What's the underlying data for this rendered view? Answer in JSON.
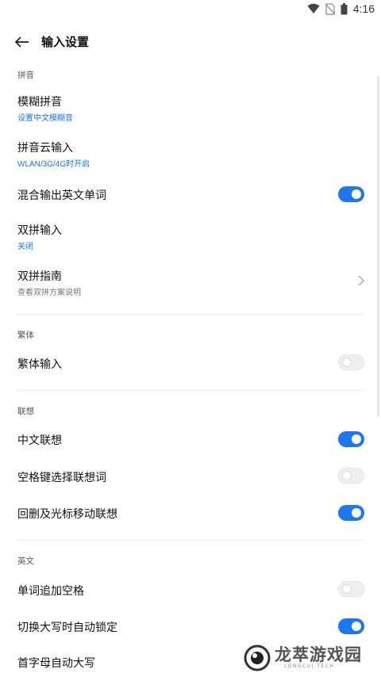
{
  "status_bar": {
    "time": "4:16"
  },
  "header": {
    "title": "输入设置"
  },
  "sections": {
    "pinyin": {
      "title": "拼音",
      "fuzzy": {
        "title": "模糊拼音",
        "subtitle": "设置中文模糊音"
      },
      "cloud": {
        "title": "拼音云输入",
        "subtitle": "WLAN/3G/4G时开启"
      },
      "mixed": {
        "title": "混合输出英文单词",
        "enabled": true
      },
      "shuangpin": {
        "title": "双拼输入",
        "subtitle": "关闭"
      },
      "guide": {
        "title": "双拼指南",
        "subtitle": "查看双拼方案说明"
      }
    },
    "traditional": {
      "title": "繁体",
      "input": {
        "title": "繁体输入",
        "enabled": false
      }
    },
    "association": {
      "title": "联想",
      "chinese": {
        "title": "中文联想",
        "enabled": true
      },
      "space": {
        "title": "空格键选择联想词",
        "enabled": false
      },
      "delete": {
        "title": "回删及光标移动联想",
        "enabled": true
      }
    },
    "english": {
      "title": "英文",
      "space": {
        "title": "单词追加空格",
        "enabled": false
      },
      "capslock": {
        "title": "切换大写时自动锁定",
        "enabled": true
      },
      "autocap": {
        "title": "首字母自动大写"
      }
    }
  },
  "watermark": {
    "text": "龙萃游戏园",
    "subtext": "LONGCUI TECH"
  },
  "colors": {
    "accent": "#1e77f0",
    "subtitle_blue": "#1a73e8"
  }
}
